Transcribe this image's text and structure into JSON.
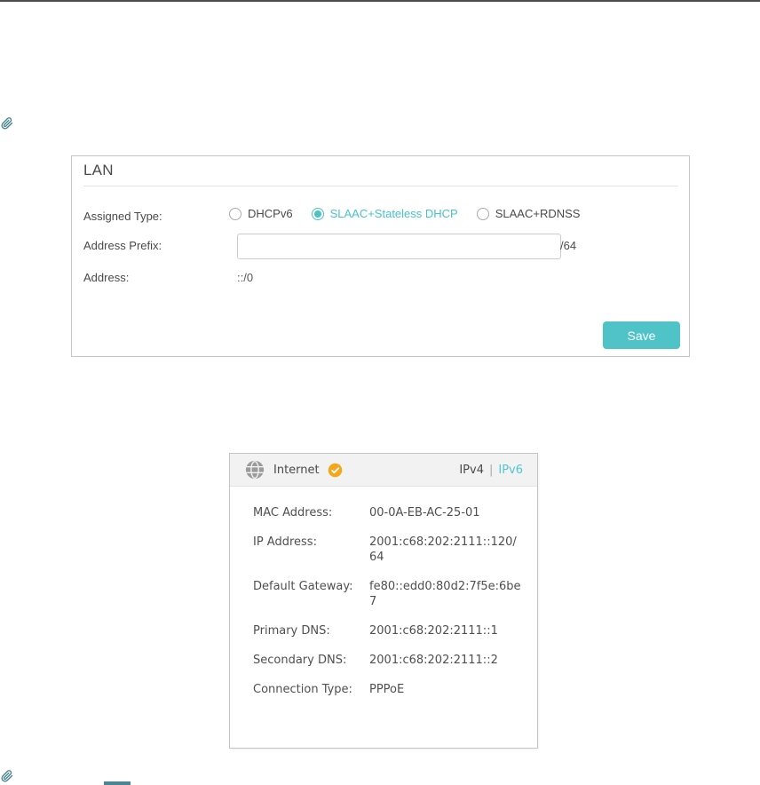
{
  "colors": {
    "accent_teal": "#4fc3c8",
    "accent_teal_text": "#47c3cc",
    "note_icon_teal": "#4a8591",
    "status_badge_orange": "#f2a71c",
    "globe_gray": "#9b9b9b"
  },
  "lan_panel": {
    "title": "LAN",
    "assigned_type": {
      "label": "Assigned Type:",
      "options": [
        {
          "label": "DHCPv6",
          "selected": false
        },
        {
          "label": "SLAAC+Stateless DHCP",
          "selected": true
        },
        {
          "label": "SLAAC+RDNSS",
          "selected": false
        }
      ]
    },
    "address_prefix": {
      "label": "Address Prefix:",
      "value": "",
      "suffix": "/64"
    },
    "address": {
      "label": "Address:",
      "value": "::/0"
    },
    "save_label": "Save"
  },
  "internet_card": {
    "title": "Internet",
    "status_icon": "connected-check",
    "tab_separator": "|",
    "tabs": [
      {
        "label": "IPv4",
        "active": false
      },
      {
        "label": "IPv6",
        "active": true
      }
    ],
    "rows": [
      {
        "label": "MAC Address:",
        "value": "00-0A-EB-AC-25-01"
      },
      {
        "label": "IP Address:",
        "value": "2001:c68:202:2111::120/64"
      },
      {
        "label": "Default Gateway:",
        "value": "fe80::edd0:80d2:7f5e:6be7"
      },
      {
        "label": "Primary DNS:",
        "value": "2001:c68:202:2111::1"
      },
      {
        "label": "Secondary DNS:",
        "value": "2001:c68:202:2111::2"
      },
      {
        "label": "Connection Type:",
        "value": "PPPoE"
      }
    ]
  }
}
